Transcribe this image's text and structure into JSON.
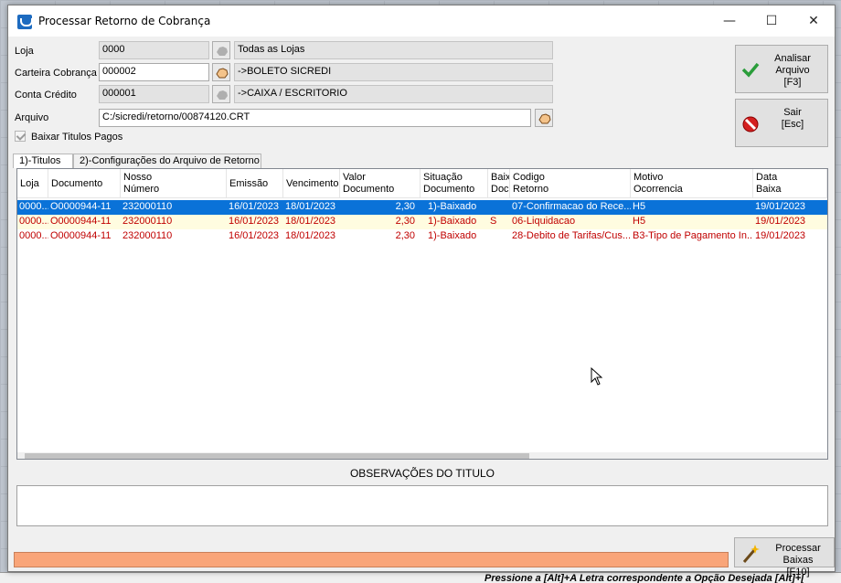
{
  "window": {
    "title": "Processar Retorno de Cobrança",
    "minimize": "—",
    "maximize": "☐",
    "close": "✕"
  },
  "form": {
    "loja": {
      "label": "Loja",
      "value": "0000",
      "desc": "Todas as Lojas"
    },
    "carteira": {
      "label": "Carteira Cobrança",
      "value": "000002",
      "desc": "->BOLETO SICREDI"
    },
    "conta": {
      "label": "Conta Crédito",
      "value": "000001",
      "desc": "->CAIXA / ESCRITORIO"
    },
    "arquivo": {
      "label": "Arquivo",
      "value": "C:/sicredi/retorno/00874120.CRT"
    },
    "baixar": {
      "label": "Baixar Titulos Pagos",
      "checked": true
    }
  },
  "buttons": {
    "analisar": {
      "line1": "Analisar Arquivo",
      "line2": "[F3]"
    },
    "sair": {
      "line1": "Sair",
      "line2": "[Esc]"
    },
    "processar": {
      "line1": "Processar Baixas",
      "line2": "[F10]"
    }
  },
  "tabs": [
    {
      "label": "1)-Titulos"
    },
    {
      "label": "2)-Configurações do Arquivo de Retorno"
    }
  ],
  "grid": {
    "columns": [
      {
        "line1": "Loja",
        "line2": ""
      },
      {
        "line1": "Documento",
        "line2": ""
      },
      {
        "line1": "Nosso",
        "line2": "Número"
      },
      {
        "line1": "Emissão",
        "line2": ""
      },
      {
        "line1": "Vencimento",
        "line2": ""
      },
      {
        "line1": "Valor",
        "line2": "Documento"
      },
      {
        "line1": "Situação",
        "line2": "Documento"
      },
      {
        "line1": "Baix",
        "line2": "Doc"
      },
      {
        "line1": "Codigo",
        "line2": "Retorno"
      },
      {
        "line1": "Motivo",
        "line2": "Ocorrencia"
      },
      {
        "line1": "Data",
        "line2": "Baixa"
      }
    ],
    "rows": [
      {
        "loja": "0000...",
        "documento": "O0000944-11",
        "nosso": "232000110",
        "emissao": "16/01/2023",
        "vencimento": "18/01/2023",
        "valor": "2,30",
        "situacao": "1)-Baixado",
        "baix": "",
        "codigo": "07-Confirmacao do Rece...",
        "motivo": "H5",
        "data": "19/01/2023",
        "selected": true
      },
      {
        "loja": "0000...",
        "documento": "O0000944-11",
        "nosso": "232000110",
        "emissao": "16/01/2023",
        "vencimento": "18/01/2023",
        "valor": "2,30",
        "situacao": "1)-Baixado",
        "baix": "S",
        "codigo": "06-Liquidacao",
        "motivo": "H5",
        "data": "19/01/2023",
        "selected": false
      },
      {
        "loja": "0000...",
        "documento": "O0000944-11",
        "nosso": "232000110",
        "emissao": "16/01/2023",
        "vencimento": "18/01/2023",
        "valor": "2,30",
        "situacao": "1)-Baixado",
        "baix": "",
        "codigo": "28-Debito de Tarifas/Cus...",
        "motivo": "B3-Tipo de Pagamento In...",
        "data": "19/01/2023",
        "selected": false
      }
    ]
  },
  "observacoes": {
    "title": "OBSERVAÇÕES DO TITULO"
  },
  "statusbar": {
    "text": "Pressione a [Alt]+A Letra correspondente a Opção Desejada  [Alt]+["
  }
}
